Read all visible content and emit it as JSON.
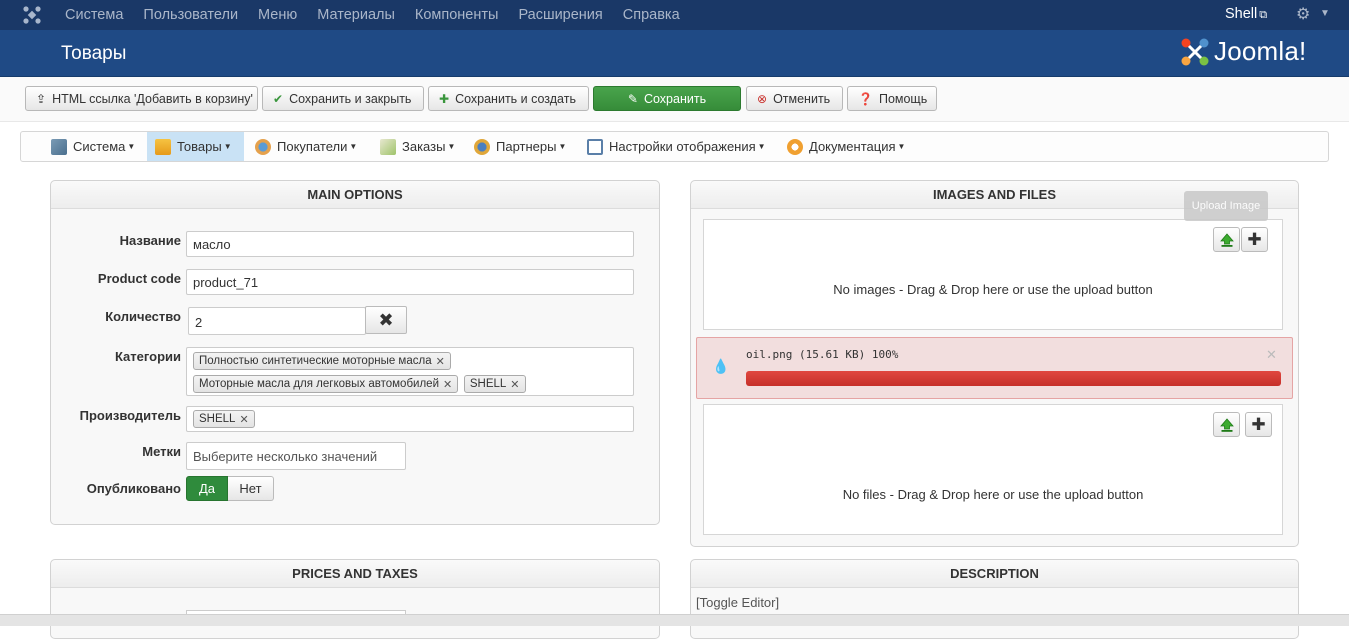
{
  "topnav": {
    "menu": [
      "Система",
      "Пользователи",
      "Меню",
      "Материалы",
      "Компоненты",
      "Расширения",
      "Справка"
    ],
    "user": "Shell"
  },
  "header": {
    "title": "Товары",
    "brand": "Joomla!"
  },
  "toolbar": {
    "html_link": "HTML ссылка 'Добавить в корзину'",
    "save_close": "Сохранить и закрыть",
    "save_new": "Сохранить и создать",
    "save": "Сохранить",
    "cancel": "Отменить",
    "help": "Помощь"
  },
  "subnav": {
    "items": [
      {
        "label": "Система"
      },
      {
        "label": "Товары"
      },
      {
        "label": "Покупатели"
      },
      {
        "label": "Заказы"
      },
      {
        "label": "Партнеры"
      },
      {
        "label": "Настройки отображения"
      },
      {
        "label": "Документация"
      }
    ]
  },
  "main_options": {
    "title": "MAIN OPTIONS",
    "name_label": "Название",
    "name_value": "масло",
    "code_label": "Product code",
    "code_value": "product_71",
    "qty_label": "Количество",
    "qty_value": "2",
    "cat_label": "Категории",
    "categories": [
      "Полностью синтетические моторные масла",
      "Моторные масла для легковых автомобилей",
      "SHELL"
    ],
    "manufacturer_label": "Производитель",
    "manufacturer": "SHELL",
    "tags_label": "Метки",
    "tags_placeholder": "Выберите несколько значений",
    "published_label": "Опубликовано",
    "yes": "Да",
    "no": "Нет"
  },
  "images_files": {
    "title": "IMAGES AND FILES",
    "tooltip": "Upload Image",
    "no_images": "No images - Drag & Drop here or use the upload button",
    "upload_file": "oil.png (15.61 KB)",
    "upload_percent": "100%",
    "upload_progress": 1.0,
    "no_files": "No files - Drag & Drop here or use the upload button"
  },
  "prices": {
    "title": "PRICES AND TAXES"
  },
  "description": {
    "title": "DESCRIPTION",
    "toggle": "[Toggle Editor]"
  },
  "colors": {
    "topbar": "#1a3867",
    "header": "#1f4a85",
    "save": "#3a963d",
    "error": "#d9534f"
  }
}
